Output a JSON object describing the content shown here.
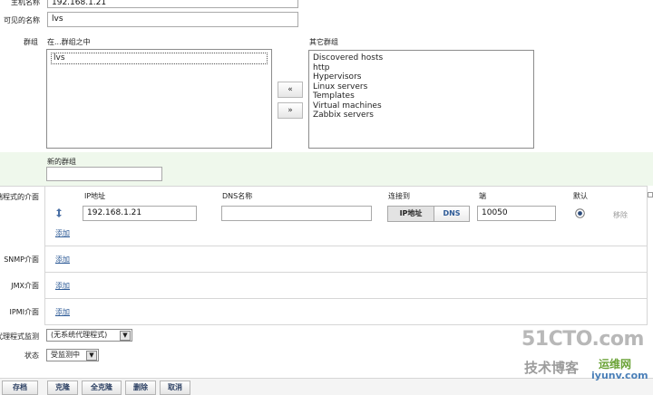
{
  "host": {
    "hostname_label": "主机名称",
    "hostname_value": "192.168.1.21",
    "visible_name_label": "可见的名称",
    "visible_name_value": "lvs"
  },
  "groups": {
    "label": "群组",
    "in_groups_label": "在...群组之中",
    "in_groups": [
      "lvs"
    ],
    "other_groups_label": "其它群组",
    "other_groups": [
      "Discovered hosts",
      "http",
      "Hypervisors",
      "Linux servers",
      "Templates",
      "Virtual machines",
      "Zabbix servers"
    ],
    "add_arrow": "«",
    "remove_arrow": "»",
    "new_group_label": "新的群组",
    "new_group_value": ""
  },
  "interfaces": {
    "agent_label": "客户端程式的介面",
    "col_ip": "IP地址",
    "col_dns": "DNS名称",
    "col_connect": "连接到",
    "col_port": "端",
    "col_default": "默认",
    "row": {
      "ip": "192.168.1.21",
      "dns": "",
      "connect_ip": "IP地址",
      "connect_dns": "DNS",
      "port": "10050",
      "remove": "移除"
    },
    "add_link": "添加",
    "snmp_label": "SNMP介面",
    "jmx_label": "JMX介面",
    "ipmi_label": "IPMI介面"
  },
  "proxy": {
    "label": "由代理程式监测",
    "value": "(无系统代理程式)"
  },
  "status": {
    "label": "状态",
    "value": "受监测中"
  },
  "buttons": {
    "save": "存档",
    "clone": "克隆",
    "full_clone": "全克隆",
    "delete": "删除",
    "cancel": "取消"
  },
  "watermark": {
    "line1": "51CTO.com",
    "line2": "技术博客",
    "line3": "运维网",
    "line4": "iyunv.com"
  },
  "colors": {
    "accent_link": "#2d5a96",
    "section_bg": "#eff8ec",
    "active_segment": "#e3e3e3"
  }
}
